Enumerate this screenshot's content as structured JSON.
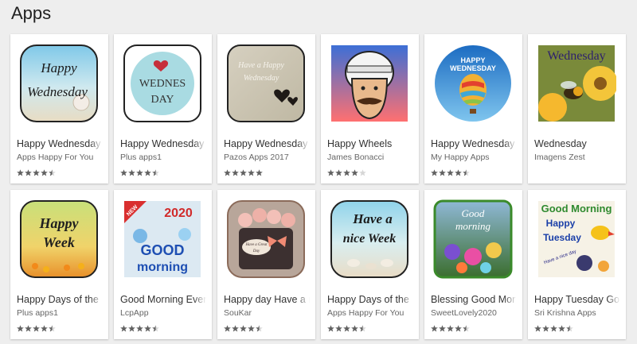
{
  "section": {
    "title": "Apps"
  },
  "apps": [
    {
      "title": "Happy Wednesday",
      "developer": "Apps Happy For You",
      "rating": 4.5,
      "icon": "happy-wednesday-beach-icon",
      "thumb_text": [
        "Happy",
        "Wednesday"
      ]
    },
    {
      "title": "Happy Wednesday",
      "developer": "Plus apps1",
      "rating": 4.5,
      "icon": "wednesday-heart-icon",
      "thumb_text": [
        "WEDNES",
        "DAY"
      ]
    },
    {
      "title": "Happy Wednesday",
      "developer": "Pazos Apps 2017",
      "rating": 5,
      "icon": "wednesday-hearts-icon",
      "thumb_text": [
        "Have a Happy",
        "Wednesday"
      ]
    },
    {
      "title": "Happy Wheels",
      "developer": "James Bonacci",
      "rating": 4,
      "icon": "happy-wheels-helmet-icon",
      "thumb_text": []
    },
    {
      "title": "Happy Wednesday",
      "developer": "My Happy Apps",
      "rating": 4.5,
      "icon": "hot-air-balloon-icon",
      "thumb_text": [
        "HAPPY",
        "WEDNESDAY"
      ]
    },
    {
      "title": "Wednesday",
      "developer": "Imagens Zest",
      "rating": 0,
      "icon": "wednesday-bee-icon",
      "thumb_text": [
        "Wednesday"
      ]
    },
    {
      "title": "Happy Days of the",
      "developer": "Plus apps1",
      "rating": 4.5,
      "icon": "happy-week-flowers-icon",
      "thumb_text": [
        "Happy",
        "Week"
      ]
    },
    {
      "title": "Good Morning Ever",
      "developer": "LcpApp",
      "rating": 4.5,
      "icon": "good-morning-2020-icon",
      "thumb_text": [
        "NEW",
        "2020",
        "GOOD",
        "morning"
      ]
    },
    {
      "title": "Happy day Have a n",
      "developer": "SouKar",
      "rating": 4.5,
      "icon": "rose-box-icon",
      "thumb_text": [
        "Have a Great",
        "Day"
      ]
    },
    {
      "title": "Happy Days of the",
      "developer": "Apps Happy For You",
      "rating": 4.5,
      "icon": "nice-week-beach-icon",
      "thumb_text": [
        "Have a",
        "nice Week"
      ]
    },
    {
      "title": "Blessing Good Mor",
      "developer": "SweetLovely2020",
      "rating": 4.5,
      "icon": "good-morning-flowers-icon",
      "thumb_text": [
        "Good",
        "morning"
      ]
    },
    {
      "title": "Happy Tuesday Go",
      "developer": "Sri Krishna Apps",
      "rating": 4.5,
      "icon": "good-morning-tuesday-bird-icon",
      "thumb_text": [
        "Good Morning",
        "Happy",
        "Tuesday",
        "Have a nice day"
      ]
    }
  ],
  "colors": {
    "star": "#616161",
    "star_empty": "#d6d6d6"
  }
}
